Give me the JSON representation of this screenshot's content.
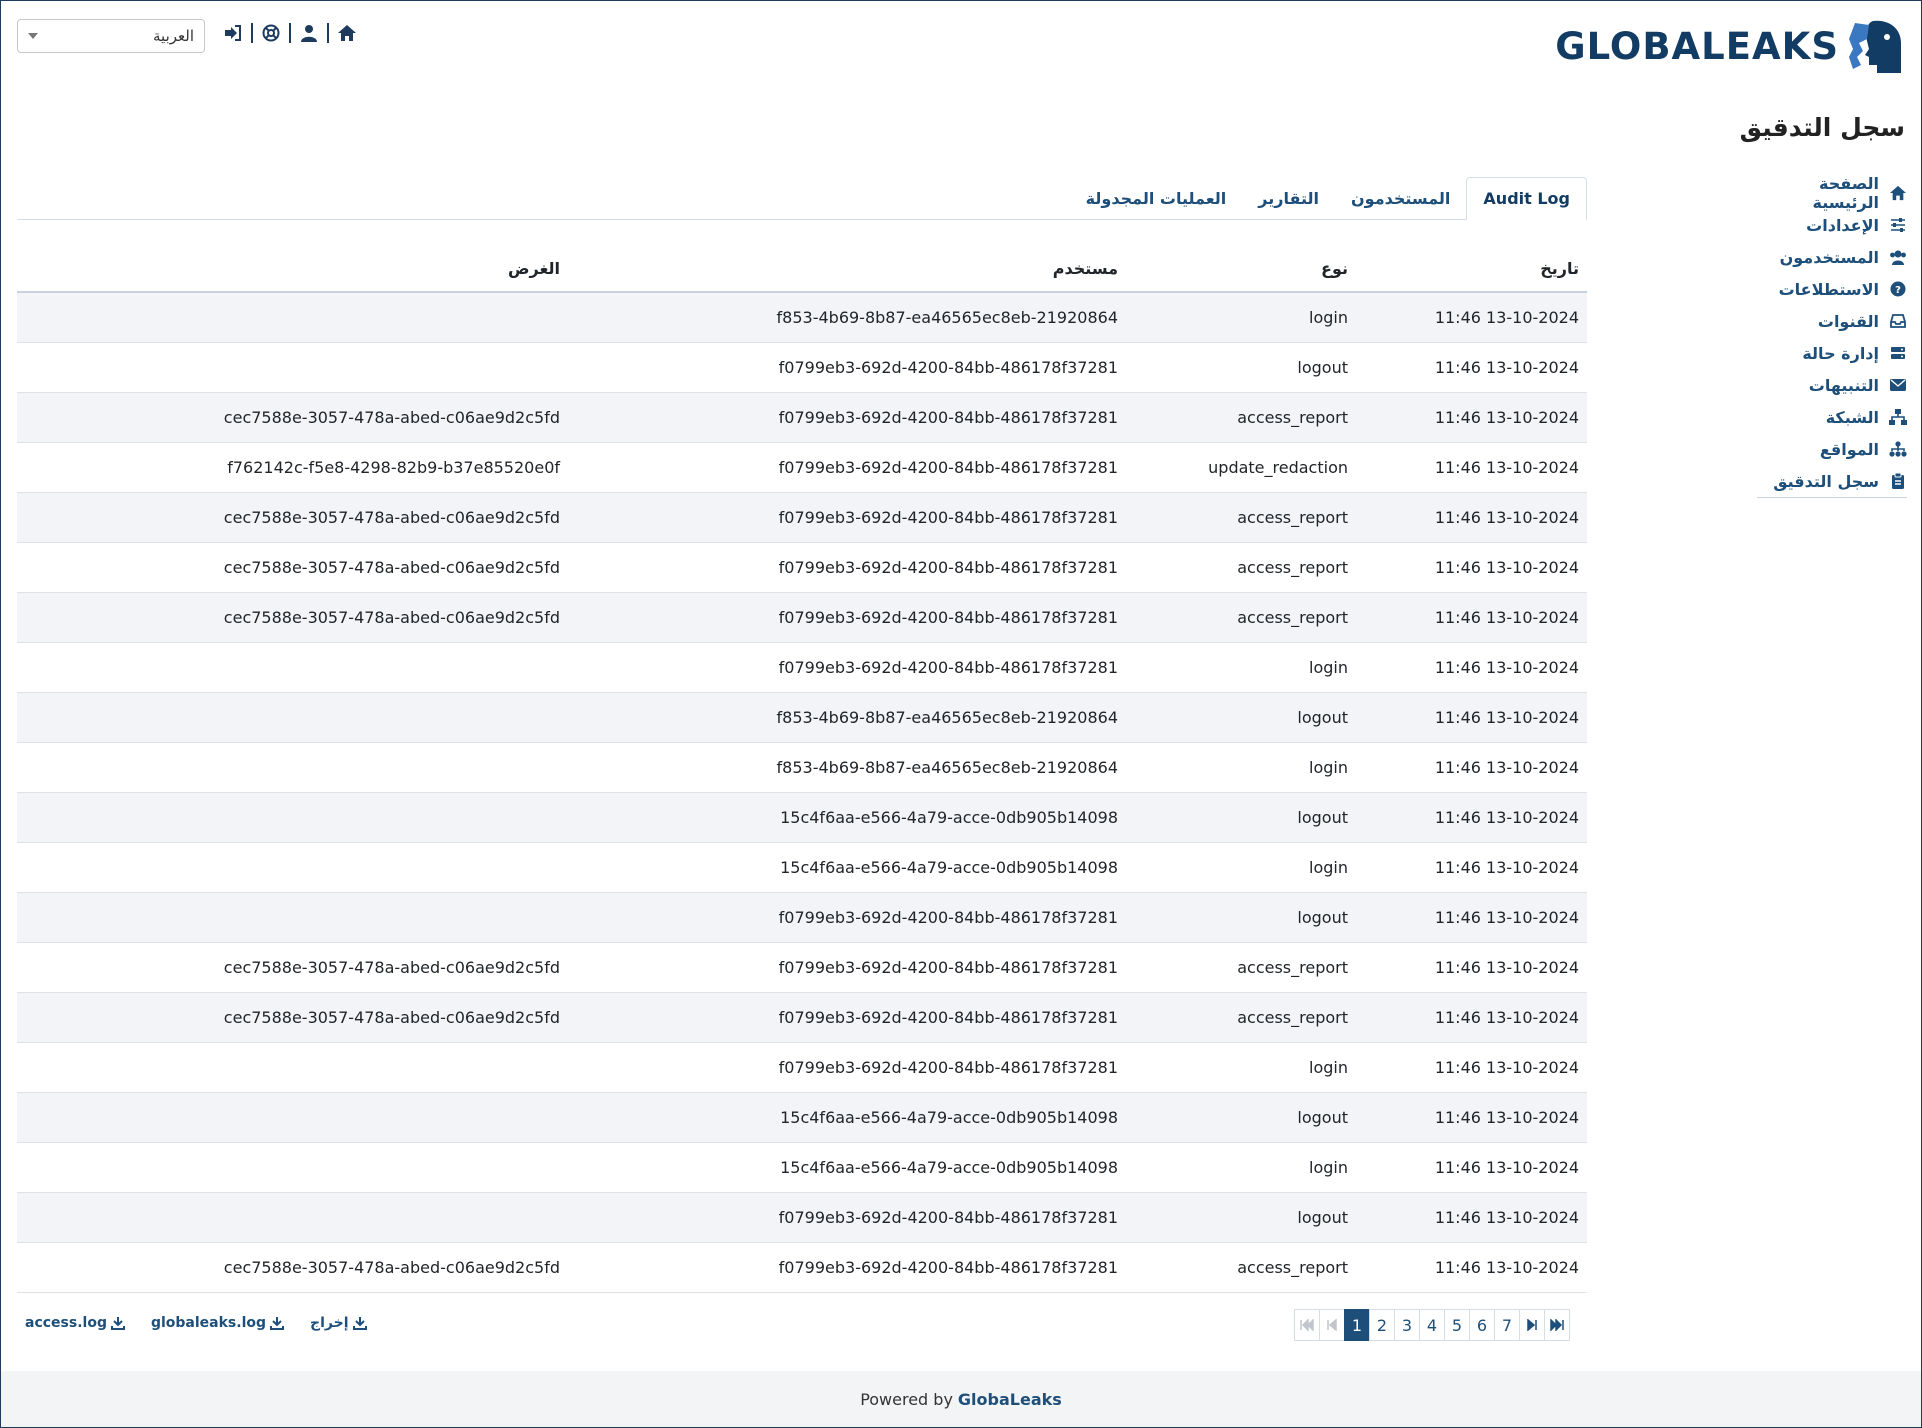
{
  "brand": {
    "name": "GLOBALEAKS",
    "primary_color": "#123c63",
    "accent_color": "#1d4f7a"
  },
  "header": {
    "language": {
      "selected": "العربية"
    },
    "icons": [
      "home-icon",
      "user-icon",
      "support-icon",
      "logout-icon"
    ]
  },
  "page": {
    "title": "سجل التدقيق"
  },
  "sidebar": {
    "items": [
      {
        "label": "الصفحة الرئيسية",
        "icon": "home-icon"
      },
      {
        "label": "الإعدادات",
        "icon": "sliders-icon"
      },
      {
        "label": "المستخدمون",
        "icon": "users-icon"
      },
      {
        "label": "الاستطلاعات",
        "icon": "question-icon"
      },
      {
        "label": "القنوات",
        "icon": "inbox-icon"
      },
      {
        "label": "إدارة حالة",
        "icon": "server-icon"
      },
      {
        "label": "التنبيهات",
        "icon": "envelope-icon"
      },
      {
        "label": "الشبكة",
        "icon": "network-icon"
      },
      {
        "label": "المواقع",
        "icon": "sitemap-icon"
      },
      {
        "label": "سجل التدقيق",
        "icon": "clipboard-icon"
      }
    ]
  },
  "tabs": [
    {
      "label": "Audit Log",
      "active": true
    },
    {
      "label": "المستخدمون"
    },
    {
      "label": "التقارير"
    },
    {
      "label": "العمليات المجدولة"
    }
  ],
  "table": {
    "headers": {
      "date": "تاريخ",
      "type": "نوع",
      "user": "مستخدم",
      "object": "الغرض"
    },
    "rows": [
      {
        "date": "13-10-2024 11:46",
        "type": "login",
        "user": "f853-4b69-8b87-ea46565ec8eb-21920864",
        "object": ""
      },
      {
        "date": "13-10-2024 11:46",
        "type": "logout",
        "user": "f0799eb3-692d-4200-84bb-486178f37281",
        "object": ""
      },
      {
        "date": "13-10-2024 11:46",
        "type": "access_report",
        "user": "f0799eb3-692d-4200-84bb-486178f37281",
        "object": "cec7588e-3057-478a-abed-c06ae9d2c5fd"
      },
      {
        "date": "13-10-2024 11:46",
        "type": "update_redaction",
        "user": "f0799eb3-692d-4200-84bb-486178f37281",
        "object": "f762142c-f5e8-4298-82b9-b37e85520e0f"
      },
      {
        "date": "13-10-2024 11:46",
        "type": "access_report",
        "user": "f0799eb3-692d-4200-84bb-486178f37281",
        "object": "cec7588e-3057-478a-abed-c06ae9d2c5fd"
      },
      {
        "date": "13-10-2024 11:46",
        "type": "access_report",
        "user": "f0799eb3-692d-4200-84bb-486178f37281",
        "object": "cec7588e-3057-478a-abed-c06ae9d2c5fd"
      },
      {
        "date": "13-10-2024 11:46",
        "type": "access_report",
        "user": "f0799eb3-692d-4200-84bb-486178f37281",
        "object": "cec7588e-3057-478a-abed-c06ae9d2c5fd"
      },
      {
        "date": "13-10-2024 11:46",
        "type": "login",
        "user": "f0799eb3-692d-4200-84bb-486178f37281",
        "object": ""
      },
      {
        "date": "13-10-2024 11:46",
        "type": "logout",
        "user": "f853-4b69-8b87-ea46565ec8eb-21920864",
        "object": ""
      },
      {
        "date": "13-10-2024 11:46",
        "type": "login",
        "user": "f853-4b69-8b87-ea46565ec8eb-21920864",
        "object": ""
      },
      {
        "date": "13-10-2024 11:46",
        "type": "logout",
        "user": "15c4f6aa-e566-4a79-acce-0db905b14098",
        "object": ""
      },
      {
        "date": "13-10-2024 11:46",
        "type": "login",
        "user": "15c4f6aa-e566-4a79-acce-0db905b14098",
        "object": ""
      },
      {
        "date": "13-10-2024 11:46",
        "type": "logout",
        "user": "f0799eb3-692d-4200-84bb-486178f37281",
        "object": ""
      },
      {
        "date": "13-10-2024 11:46",
        "type": "access_report",
        "user": "f0799eb3-692d-4200-84bb-486178f37281",
        "object": "cec7588e-3057-478a-abed-c06ae9d2c5fd"
      },
      {
        "date": "13-10-2024 11:46",
        "type": "access_report",
        "user": "f0799eb3-692d-4200-84bb-486178f37281",
        "object": "cec7588e-3057-478a-abed-c06ae9d2c5fd"
      },
      {
        "date": "13-10-2024 11:46",
        "type": "login",
        "user": "f0799eb3-692d-4200-84bb-486178f37281",
        "object": ""
      },
      {
        "date": "13-10-2024 11:46",
        "type": "logout",
        "user": "15c4f6aa-e566-4a79-acce-0db905b14098",
        "object": ""
      },
      {
        "date": "13-10-2024 11:46",
        "type": "login",
        "user": "15c4f6aa-e566-4a79-acce-0db905b14098",
        "object": ""
      },
      {
        "date": "13-10-2024 11:46",
        "type": "logout",
        "user": "f0799eb3-692d-4200-84bb-486178f37281",
        "object": ""
      },
      {
        "date": "13-10-2024 11:46",
        "type": "access_report",
        "user": "f0799eb3-692d-4200-84bb-486178f37281",
        "object": "cec7588e-3057-478a-abed-c06ae9d2c5fd"
      }
    ]
  },
  "pagination": {
    "pages": [
      "1",
      "2",
      "3",
      "4",
      "5",
      "6",
      "7"
    ],
    "current": "1"
  },
  "downloads": [
    {
      "label": "access.log"
    },
    {
      "label": "globaleaks.log"
    },
    {
      "label": "إخراج"
    }
  ],
  "footer": {
    "prefix": "Powered by",
    "link": "GlobaLeaks"
  }
}
